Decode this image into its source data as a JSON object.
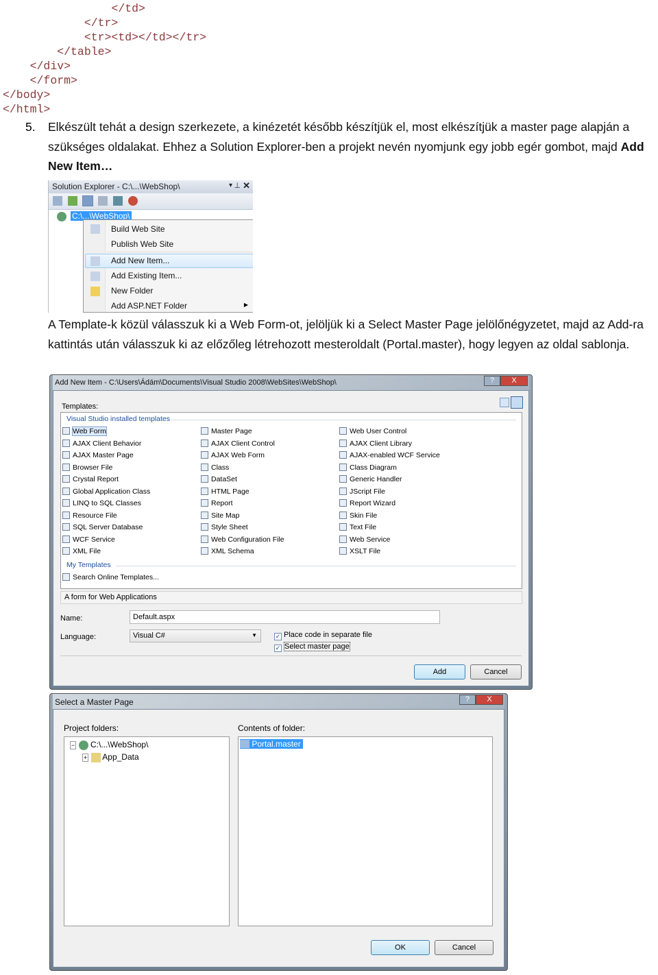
{
  "code_lines": [
    {
      "indent": "                ",
      "text": "</td>"
    },
    {
      "indent": "            ",
      "text": "</tr>"
    },
    {
      "indent": "            ",
      "text": "<tr><td></td></tr>"
    },
    {
      "indent": "        ",
      "text": "</table>"
    },
    {
      "indent": "    ",
      "text": "</div>"
    },
    {
      "indent": "    ",
      "text": "</form>"
    },
    {
      "indent": "",
      "text": "</body>"
    },
    {
      "indent": "",
      "text": "</html>"
    }
  ],
  "step": {
    "number": "5.",
    "text": "Elkészült tehát a design szerkezete, a kinézetét később készítjük el, most elkészítjük a master page alapján a szükséges oldalakat.  Ehhez a Solution Explorer-ben a projekt nevén nyomjunk egy jobb egér gombot, majd ",
    "bold": "Add New Item…"
  },
  "solution_explorer": {
    "title": "Solution Explorer - C:\\...\\WebShop\\",
    "root_node": "C:\\...\\WebShop\\",
    "menu_items": [
      "Build Web Site",
      "Publish Web Site",
      "Add New Item...",
      "Add Existing Item...",
      "New Folder",
      "Add ASP.NET Folder"
    ],
    "highlighted_item": "Add New Item..."
  },
  "paragraph2": "A Template-k közül válasszuk ki a Web Form-ot, jelöljük ki a Select Master Page jelölőnégyzetet, majd az Add-ra kattintás után válasszuk ki az előzőleg létrehozott mesteroldalt (Portal.master), hogy legyen az oldal sablonja.",
  "add_new_item": {
    "title": "Add New Item - C:\\Users\\Ádám\\Documents\\Visual Studio 2008\\WebSites\\WebShop\\",
    "help": "?",
    "close": "X",
    "templates_label": "Templates:",
    "installed_group": "Visual Studio installed templates",
    "columns": [
      [
        "Web Form",
        "AJAX Client Behavior",
        "AJAX Master Page",
        "Browser File",
        "Crystal Report",
        "Global Application Class",
        "LINQ to SQL Classes",
        "Resource File",
        "SQL Server Database",
        "WCF Service",
        "XML File"
      ],
      [
        "Master Page",
        "AJAX Client Control",
        "AJAX Web Form",
        "Class",
        "DataSet",
        "HTML Page",
        "Report",
        "Site Map",
        "Style Sheet",
        "Web Configuration File",
        "XML Schema"
      ],
      [
        "Web User Control",
        "AJAX Client Library",
        "AJAX-enabled WCF Service",
        "Class Diagram",
        "Generic Handler",
        "JScript File",
        "Report Wizard",
        "Skin File",
        "Text File",
        "Web Service",
        "XSLT File"
      ]
    ],
    "selected_template": "Web Form",
    "my_templates_group": "My Templates",
    "search_online": "Search Online Templates...",
    "description": "A form for Web Applications",
    "name_label": "Name:",
    "name_value": "Default.aspx",
    "language_label": "Language:",
    "language_value": "Visual C#",
    "place_code_label": "Place code in separate file",
    "place_code_checked": true,
    "select_master_label": "Select master page",
    "select_master_checked": true,
    "add_button": "Add",
    "cancel_button": "Cancel"
  },
  "select_master": {
    "title": "Select a Master Page",
    "help": "?",
    "close": "X",
    "project_folders_label": "Project folders:",
    "tree": [
      "C:\\...\\WebShop\\",
      "App_Data"
    ],
    "contents_label": "Contents of folder:",
    "files": [
      "Portal.master"
    ],
    "ok_button": "OK",
    "cancel_button": "Cancel"
  },
  "colors": {
    "code_tag": "#8a3b3b",
    "code_bracket": "#3c3ca0",
    "selection": "#3399ff",
    "group_heading": "#1f4ea0"
  }
}
